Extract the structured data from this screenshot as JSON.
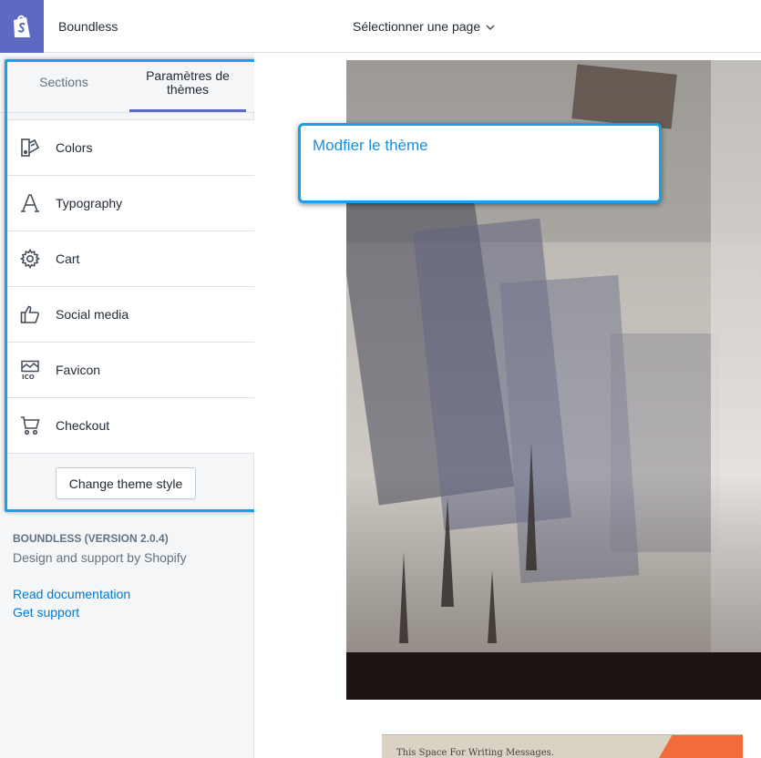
{
  "header": {
    "store_name": "Boundless",
    "page_selector": "Sélectionner une page"
  },
  "sidebar": {
    "tabs": [
      {
        "label": "Sections"
      },
      {
        "label": "Paramètres de thèmes"
      }
    ],
    "items": [
      {
        "label": "Colors",
        "icon": "colors-icon"
      },
      {
        "label": "Typography",
        "icon": "typography-icon"
      },
      {
        "label": "Cart",
        "icon": "gear-icon"
      },
      {
        "label": "Social media",
        "icon": "thumbs-up-icon"
      },
      {
        "label": "Favicon",
        "icon": "favicon-icon"
      },
      {
        "label": "Checkout",
        "icon": "cart-icon"
      }
    ],
    "change_style_button": "Change theme style",
    "version": "BOUNDLESS (VERSION 2.0.4)",
    "support_text": "Design and support by Shopify",
    "links": {
      "docs": "Read documentation",
      "support": "Get support"
    }
  },
  "preview": {
    "postcard_text": "This Space For Writing Messages."
  },
  "tooltip": {
    "text": "Modfier le thème"
  },
  "colors": {
    "brand": "#5c6ac4",
    "highlight": "#1ba1e2",
    "link": "#007ace",
    "accent_orange": "#f26b3a"
  }
}
